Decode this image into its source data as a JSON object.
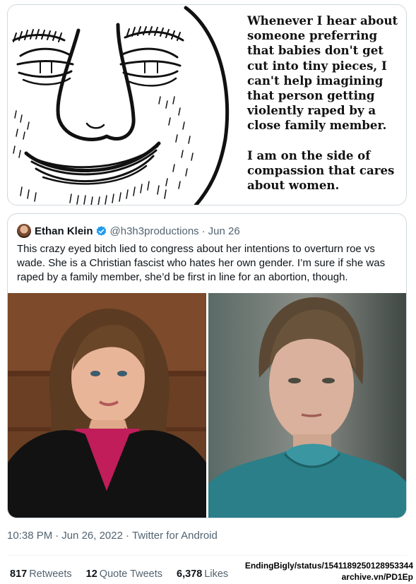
{
  "meme": {
    "icon": "smiling-face-drawing",
    "text": "Whenever I hear about someone preferring that babies don't get cut into tiny pieces, I can't help imagining that person getting violently raped by a close family member.\n\nI am on the side of compassion that cares about women."
  },
  "quoted_tweet": {
    "author_name": "Ethan Klein",
    "handle": "@h3h3productions",
    "separator": "·",
    "date": "Jun 26",
    "verified_icon": "verified-badge-icon",
    "body": "This crazy eyed bitch lied to congress about her intentions to overturn roe vs wade. She is a Christian fascist who hates her own gender. I’m sure if she was raped by a family member, she’d be first in line for an abortion, though.",
    "photos": [
      "portrait-woman-judicial-robe",
      "portrait-woman-teal-dress"
    ]
  },
  "tweet_meta": {
    "time": "10:38 PM",
    "separator": "·",
    "date": "Jun 26, 2022",
    "source": "Twitter for Android"
  },
  "stats": {
    "retweets_count": "817",
    "retweets_label": "Retweets",
    "quotes_count": "12",
    "quotes_label": "Quote Tweets",
    "likes_count": "6,378",
    "likes_label": "Likes"
  },
  "archive": {
    "path": "EndingBigly/status/1541189250128953344",
    "link": "archive.vn/PD1Ep"
  },
  "colors": {
    "secondary_text": "#536471",
    "verified_blue": "#1d9bf0",
    "border": "#cfd9de"
  }
}
